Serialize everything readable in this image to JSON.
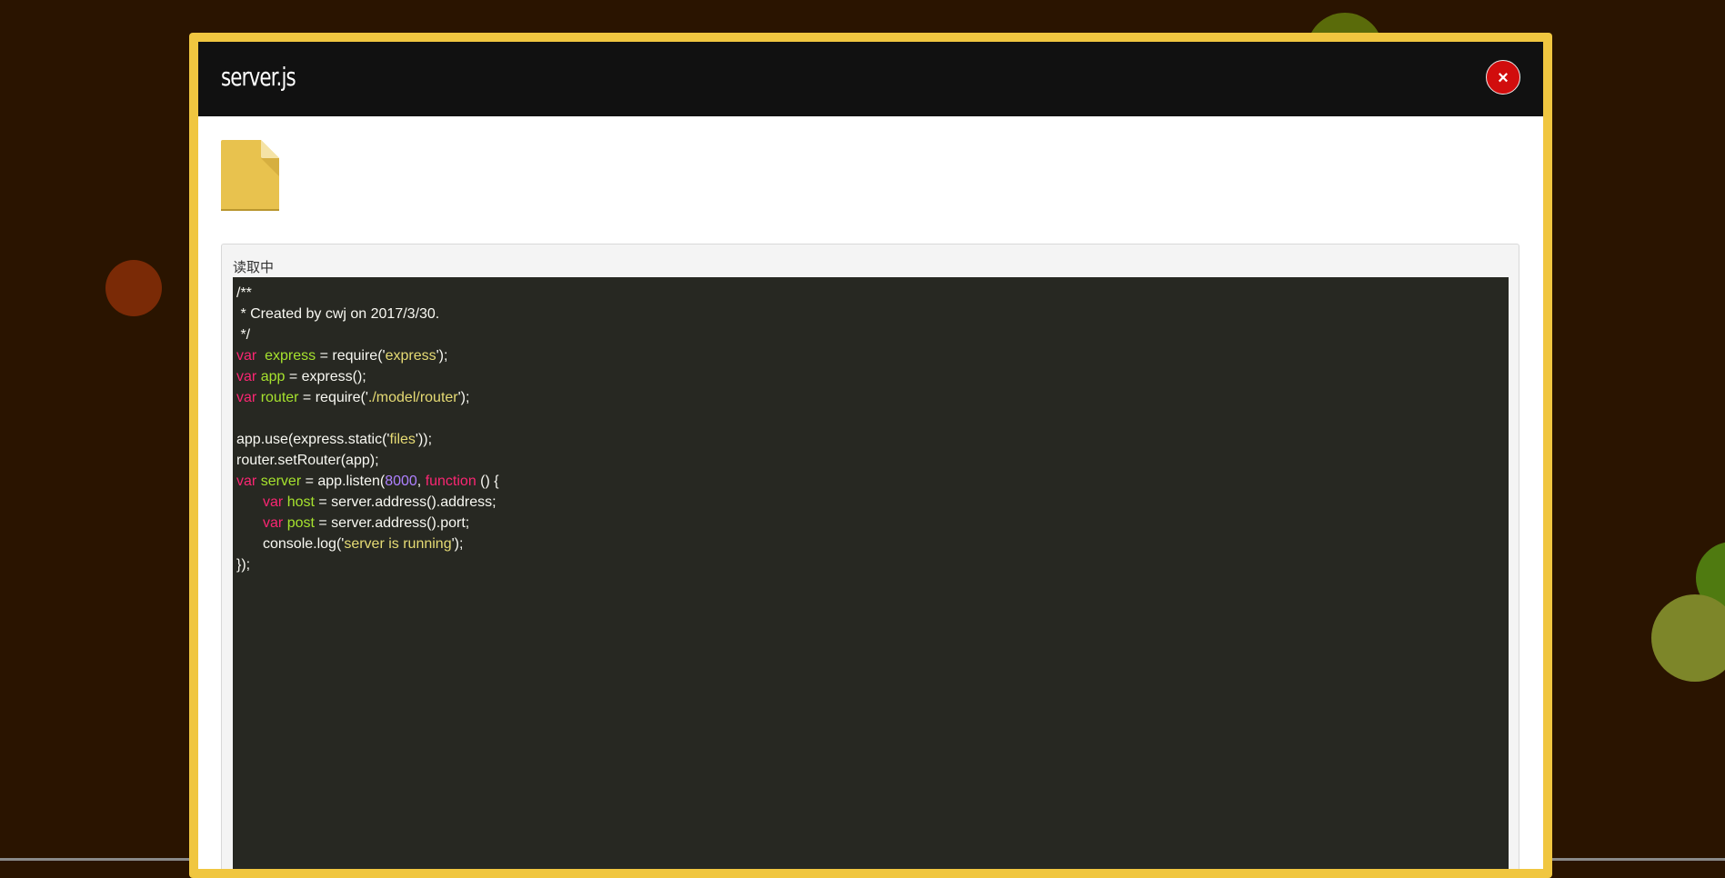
{
  "modal": {
    "title": "server.js",
    "close_label": "×",
    "file_icon": "file-icon",
    "status_text": "读取中"
  },
  "colors": {
    "background": "#2a1400",
    "modal_border": "#f0c640",
    "header": "#111111",
    "close_button": "#d10d0d",
    "code_background": "#272822",
    "keyword": "#f92672",
    "identifier": "#a6e22e",
    "string": "#e6db74",
    "number": "#ae81ff"
  },
  "code": {
    "l1": "/**",
    "l2": " * Created by cwj on 2017/3/30.",
    "l3": " */",
    "l4": {
      "kw": "var",
      "name": "express",
      "op": " = require('",
      "str": "express",
      "end": "');"
    },
    "l5": {
      "kw": "var",
      "name": "app",
      "rest": " = express();"
    },
    "l6": {
      "kw": "var",
      "name": "router",
      "op": " = require('",
      "str": "./model/router",
      "end": "');"
    },
    "l8": {
      "pre": "app.use(express.static('",
      "str": "files",
      "end": "'));"
    },
    "l9": "router.setRouter(app);",
    "l10": {
      "kw": "var",
      "name": "server",
      "op": " = app.listen(",
      "num": "8000",
      "comma": ", ",
      "kw2": "function",
      "end": " () {"
    },
    "l11": {
      "kw": "var",
      "name": "host",
      "rest": " = server.address().address;"
    },
    "l12": {
      "kw": "var",
      "name": "post",
      "rest": " = server.address().port;"
    },
    "l13": {
      "pre": "console.log('",
      "str": "server is running",
      "end": "');"
    },
    "l14": "});"
  }
}
